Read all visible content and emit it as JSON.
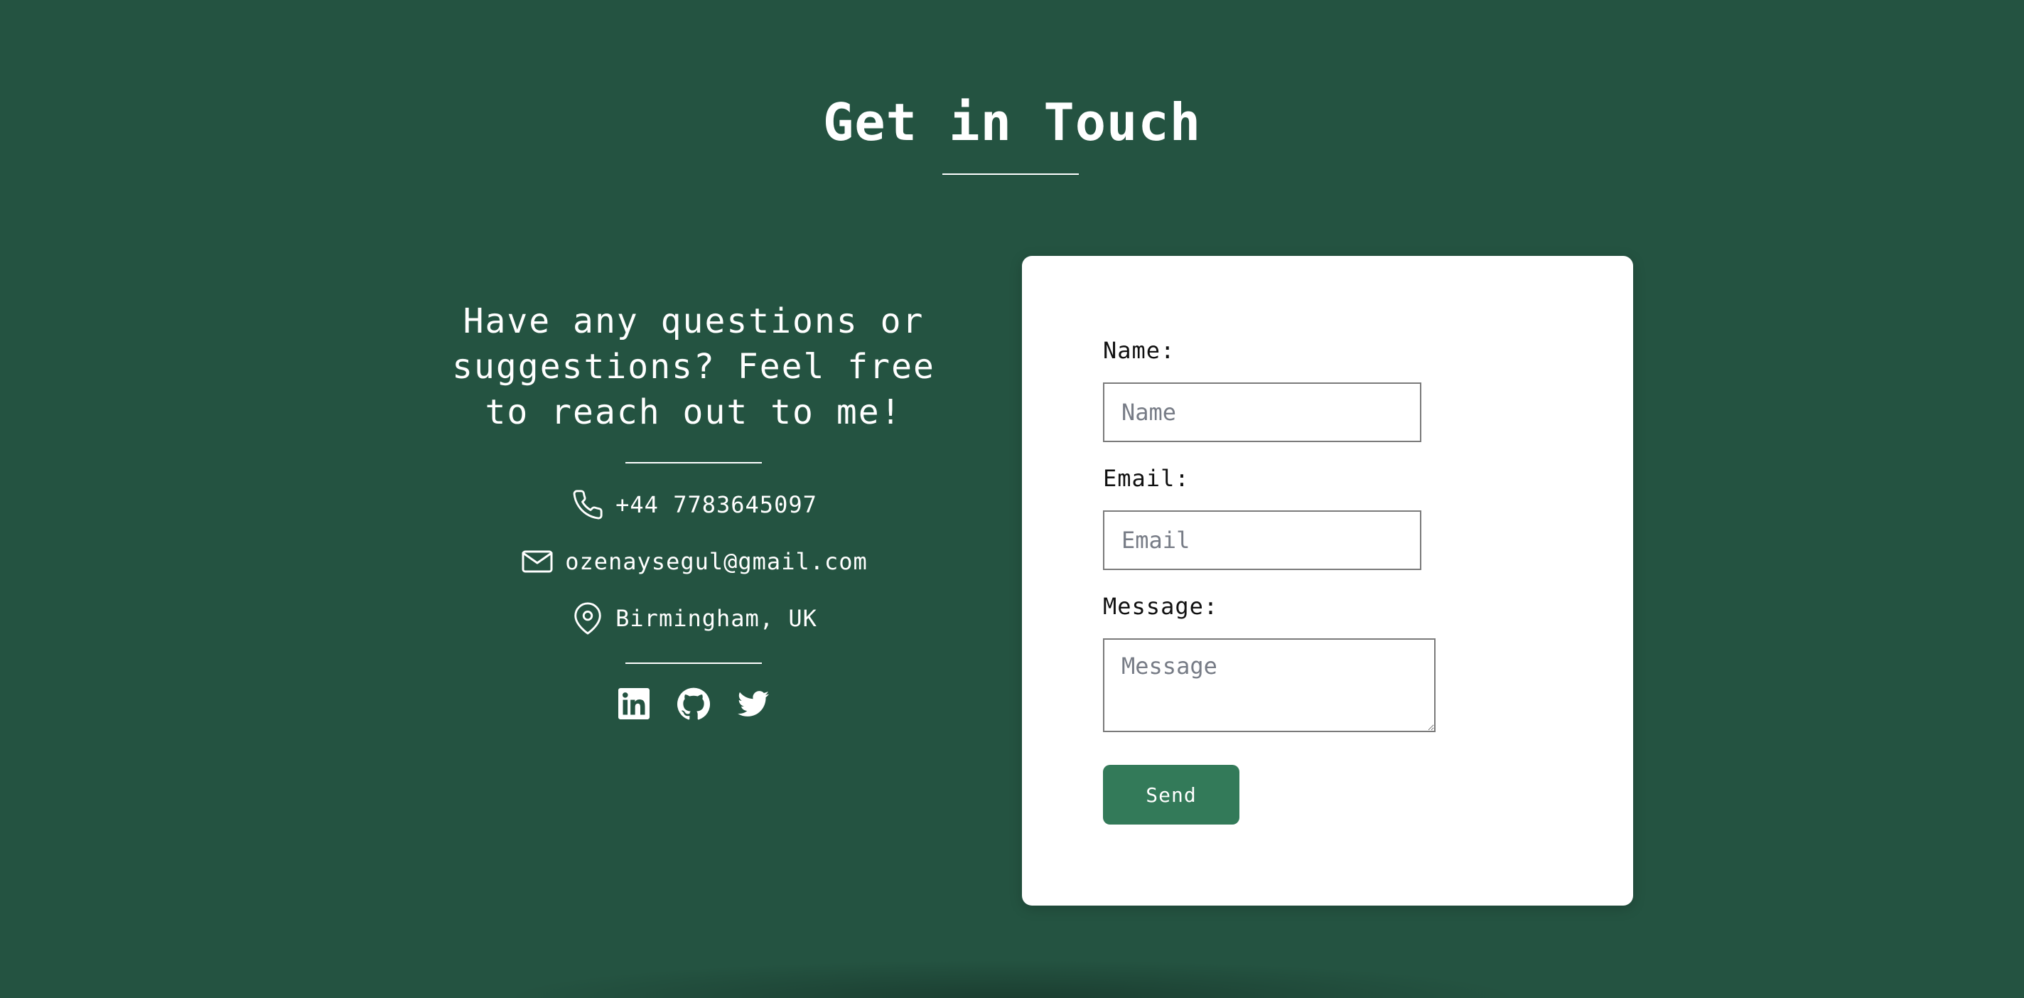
{
  "page": {
    "title": "Get in Touch",
    "background_color": "#245341"
  },
  "info": {
    "heading": "Have any questions or suggestions? Feel free to reach out to me!",
    "contacts": [
      {
        "icon": "phone-icon",
        "text": "+44 7783645097"
      },
      {
        "icon": "envelope-icon",
        "text": "ozenaysegul@gmail.com"
      },
      {
        "icon": "map-pin-icon",
        "text": "Birmingham, UK"
      }
    ],
    "socials": [
      "linkedin-icon",
      "github-icon",
      "twitter-icon"
    ]
  },
  "form": {
    "name_label": "Name:",
    "name_placeholder": "Name",
    "name_value": "",
    "email_label": "Email:",
    "email_placeholder": "Email",
    "email_value": "",
    "message_label": "Message:",
    "message_placeholder": "Message",
    "message_value": "",
    "send_label": "Send",
    "button_color": "#337a59"
  }
}
